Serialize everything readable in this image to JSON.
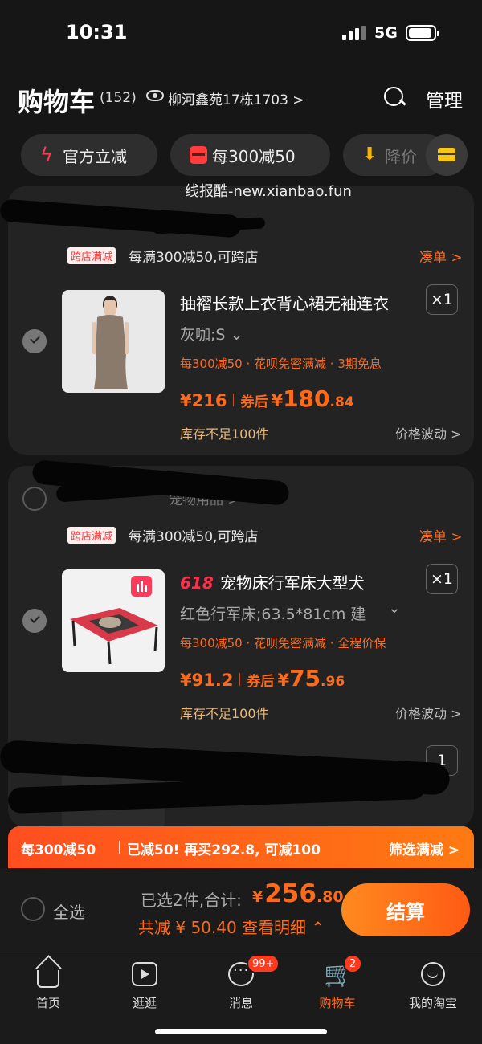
{
  "status_bar": {
    "time": "10:31",
    "network": "5G"
  },
  "header": {
    "title": "购物车",
    "count": "(152)",
    "address": "柳河鑫苑17栋1703 >",
    "manage": "管理"
  },
  "chips": [
    {
      "label": "官方立减",
      "icon": "bolt-icon"
    },
    {
      "label": "每300减50",
      "icon": "discount-icon"
    },
    {
      "label": "降价",
      "icon": "arrow-down-icon"
    }
  ],
  "watermark": "线报酷-new.xianbao.fun",
  "items": [
    {
      "promo_tag": "跨店满减",
      "promo_text": "每满300减50,可跨店",
      "coudan": "凑单 >",
      "name": "抽褶长款上衣背心裙无袖连衣",
      "qty": "×1",
      "spec": "灰咖;S ⌄",
      "benefits": "每300减50 · 花呗免密满减 · 3期免息",
      "price": "¥216",
      "coupon_label": "券后",
      "coupon_cur": "¥",
      "coupon_int": "180",
      "coupon_dec": ".84",
      "stock": "库存不足100件",
      "fluct": "价格波动 >"
    },
    {
      "store": "宠物用品 >",
      "promo_tag": "跨店满减",
      "promo_text": "每满300减50,可跨店",
      "coudan": "凑单 >",
      "badge": "618",
      "name": "宠物床行军床大型犬",
      "qty": "×1",
      "spec": "红色行军床;63.5*81cm 建",
      "spec_arrow": "⌄",
      "benefits": "每300减50 · 花呗免密满减 · 全程价保",
      "price": "¥91.2",
      "coupon_label": "券后",
      "coupon_cur": "¥",
      "coupon_int": "75",
      "coupon_dec": ".96",
      "stock": "库存不足100件",
      "fluct": "价格波动 >"
    }
  ],
  "partial_item": {
    "qty": "1"
  },
  "banner": {
    "left": "每300减50",
    "middle": "已减50! 再买292.8, 可减100",
    "right": "筛选满减 >"
  },
  "checkout": {
    "select_all": "全选",
    "selected": "已选2件,合计:",
    "total_cur": "¥",
    "total_int": "256",
    "total_dec": ".80",
    "saved": "共减 ¥ 50.40  查看明细 ⌃",
    "button": "结算"
  },
  "tabs": [
    {
      "label": "首页",
      "icon": "home-icon"
    },
    {
      "label": "逛逛",
      "icon": "video-icon"
    },
    {
      "label": "消息",
      "icon": "message-icon",
      "badge": "99+"
    },
    {
      "label": "购物车",
      "icon": "cart-icon",
      "badge": "2",
      "active": true
    },
    {
      "label": "我的淘宝",
      "icon": "smile-icon"
    }
  ],
  "colors": {
    "accent": "#ff6a1a",
    "background": "#161616",
    "card": "#232323"
  }
}
